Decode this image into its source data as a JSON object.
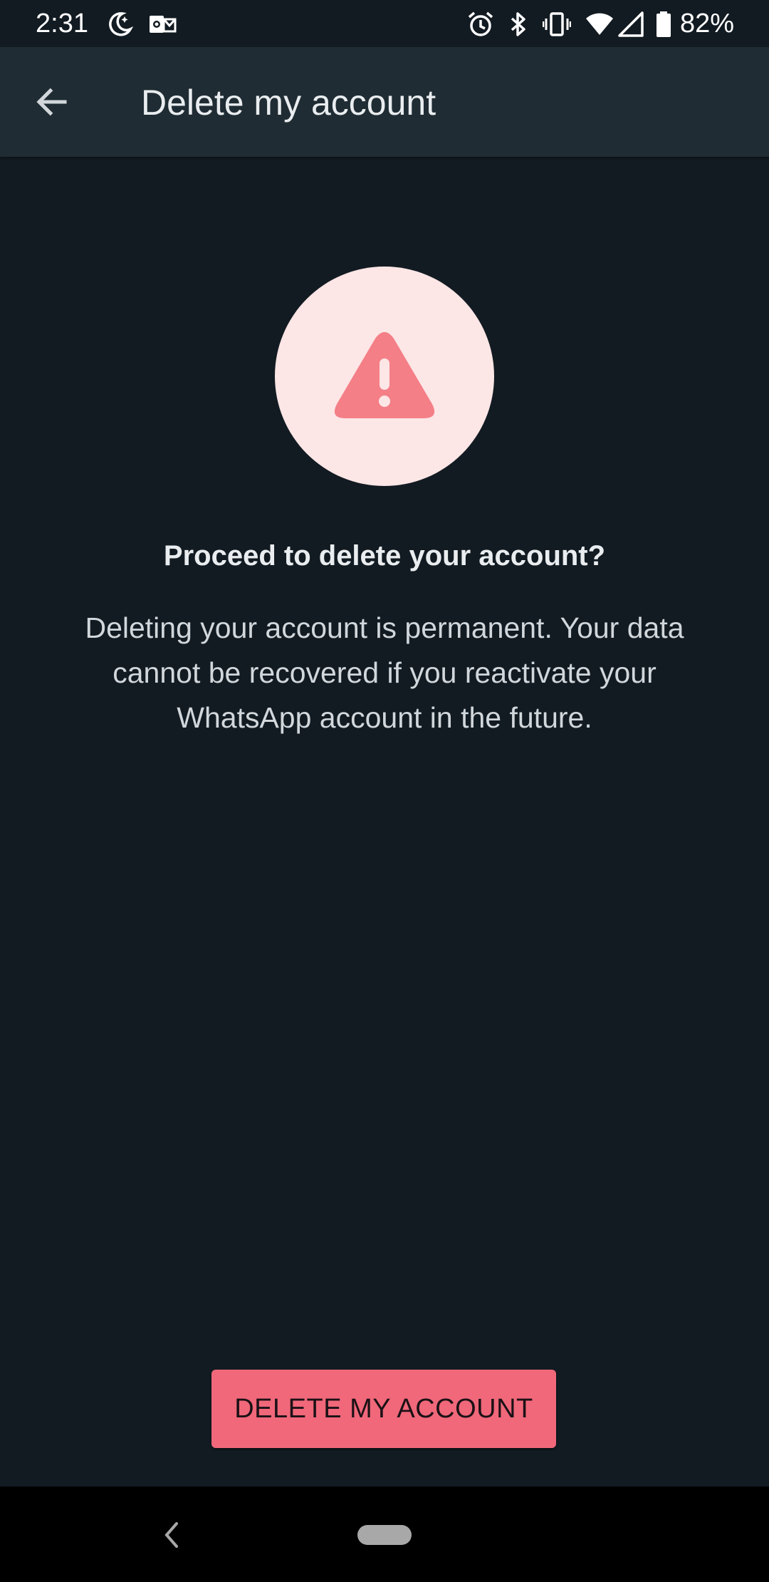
{
  "status_bar": {
    "time": "2:31",
    "battery_percent": "82%",
    "icons": [
      "do-not-disturb-moon-icon",
      "outlook-icon",
      "alarm-icon",
      "bluetooth-icon",
      "vibrate-icon",
      "wifi-icon",
      "signal-icon",
      "battery-icon"
    ]
  },
  "app_bar": {
    "title": "Delete my account",
    "back_icon": "arrow-left-icon"
  },
  "main": {
    "warning_icon": "warning-triangle-icon",
    "prompt_title": "Proceed to delete your account?",
    "prompt_body": "Deleting your account is permanent. Your data cannot be recovered if you reactivate your WhatsApp account in the future.",
    "delete_button_label": "DELETE MY ACCOUNT"
  },
  "nav_bar": {
    "back_icon": "nav-back-chevron-icon",
    "home_icon": "home-pill-icon"
  },
  "colors": {
    "background": "#121b22",
    "app_bar": "#202c33",
    "warning_circle": "#fde6e6",
    "warning_triangle": "#f47f87",
    "delete_button": "#f0687a"
  }
}
